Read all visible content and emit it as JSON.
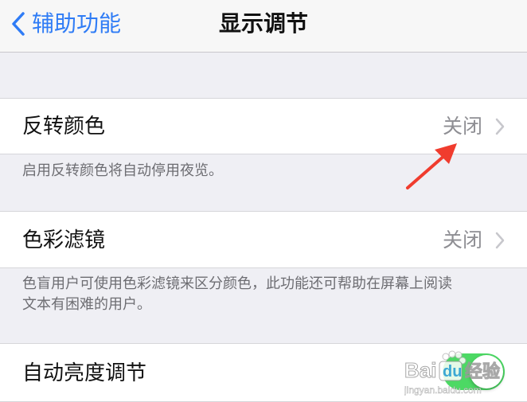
{
  "navbar": {
    "back_label": "辅助功能",
    "title": "显示调节"
  },
  "settings": {
    "invert_colors": {
      "label": "反转颜色",
      "value": "关闭",
      "footer": "启用反转颜色将自动停用夜览。"
    },
    "color_filters": {
      "label": "色彩滤镜",
      "value": "关闭",
      "footer_line1": "色盲用户可使用色彩滤镜来区分颜色，此功能还可帮助在屏幕上阅读",
      "footer_line2": "文本有困难的用户。"
    },
    "auto_brightness": {
      "label": "自动亮度调节",
      "toggle_on": true
    }
  },
  "watermark": {
    "brand": "Baidu经验",
    "url": "jingyan.baidu.com"
  },
  "colors": {
    "accent": "#2f7cf6",
    "toggle_on": "#4cd964",
    "annotation": "#f03c2e"
  }
}
